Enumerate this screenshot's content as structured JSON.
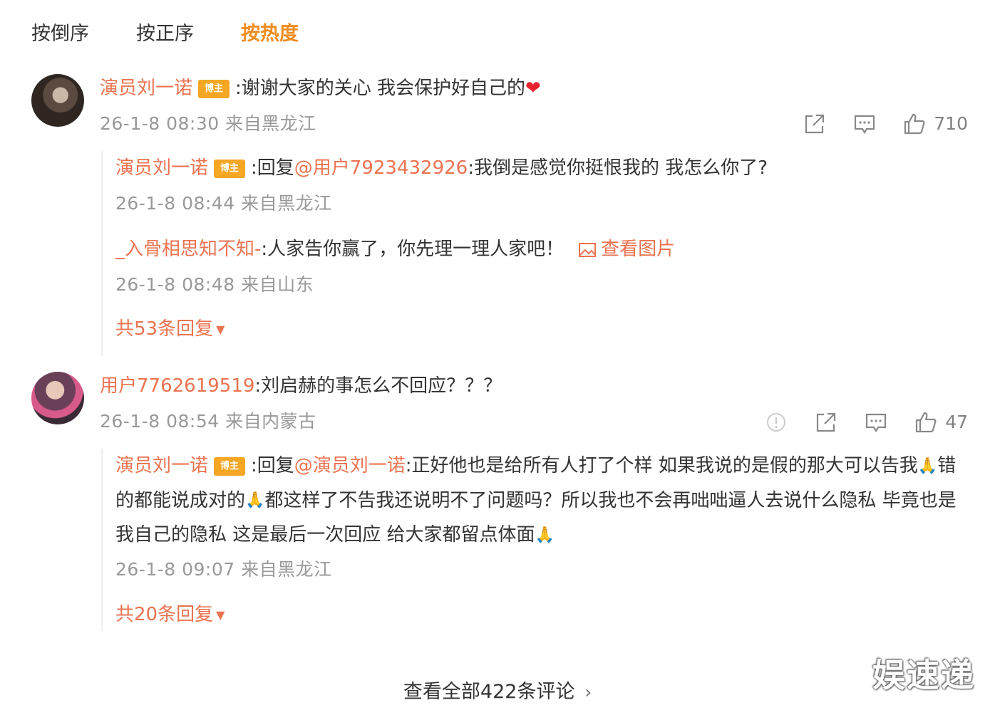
{
  "tabs": [
    "按倒序",
    "按正序",
    "按热度"
  ],
  "comments": [
    {
      "user": "演员刘一诺",
      "badge": "博主",
      "text": ":谢谢大家的关心 我会保护好自己的",
      "heart": "❤",
      "meta": "26-1-8 08:30 来自黑龙江",
      "likes": "710",
      "replies": [
        {
          "user": "演员刘一诺",
          "badge": "博主",
          "prefix": ":回复",
          "mention": "@用户7923432926",
          "text": ":我倒是感觉你挺恨我的 我怎么你了?",
          "meta": "26-1-8 08:44 来自黑龙江"
        },
        {
          "user": "_入骨相思知不知-",
          "text": ":人家告你赢了，你先理一理人家吧！",
          "view_image": "查看图片",
          "meta": "26-1-8 08:48 来自山东"
        }
      ],
      "more": "共53条回复"
    },
    {
      "user": "用户7762619519",
      "text": ":刘启赫的事怎么不回应？？？",
      "meta": "26-1-8 08:54 来自内蒙古",
      "likes": "47",
      "replies": [
        {
          "user": "演员刘一诺",
          "badge": "博主",
          "prefix": ":回复",
          "mention": "@演员刘一诺",
          "text1": ":正好他也是给所有人打了个样 如果我说的是假的那大可以告我",
          "text2": "错的都能说成对的",
          "text3": "都这样了不告我还说明不了问题吗？所以我也不会再咄咄逼人去说什么隐私 毕竟也是我自己的隐私 这是最后一次回应 给大家都留点体面",
          "emoji": "🙏",
          "meta": "26-1-8 09:07 来自黑龙江"
        }
      ],
      "more": "共20条回复"
    }
  ],
  "footer": "查看全部422条评论",
  "footer_chevron": "›",
  "watermark": "娱速递",
  "colors": {
    "accent": "#f08c1e",
    "username": "#eb7350",
    "meta": "#999999",
    "badge": "#f5a623"
  },
  "icons": [
    "share-icon",
    "comment-icon",
    "like-icon",
    "report-icon",
    "image-icon",
    "caret-down-icon"
  ]
}
